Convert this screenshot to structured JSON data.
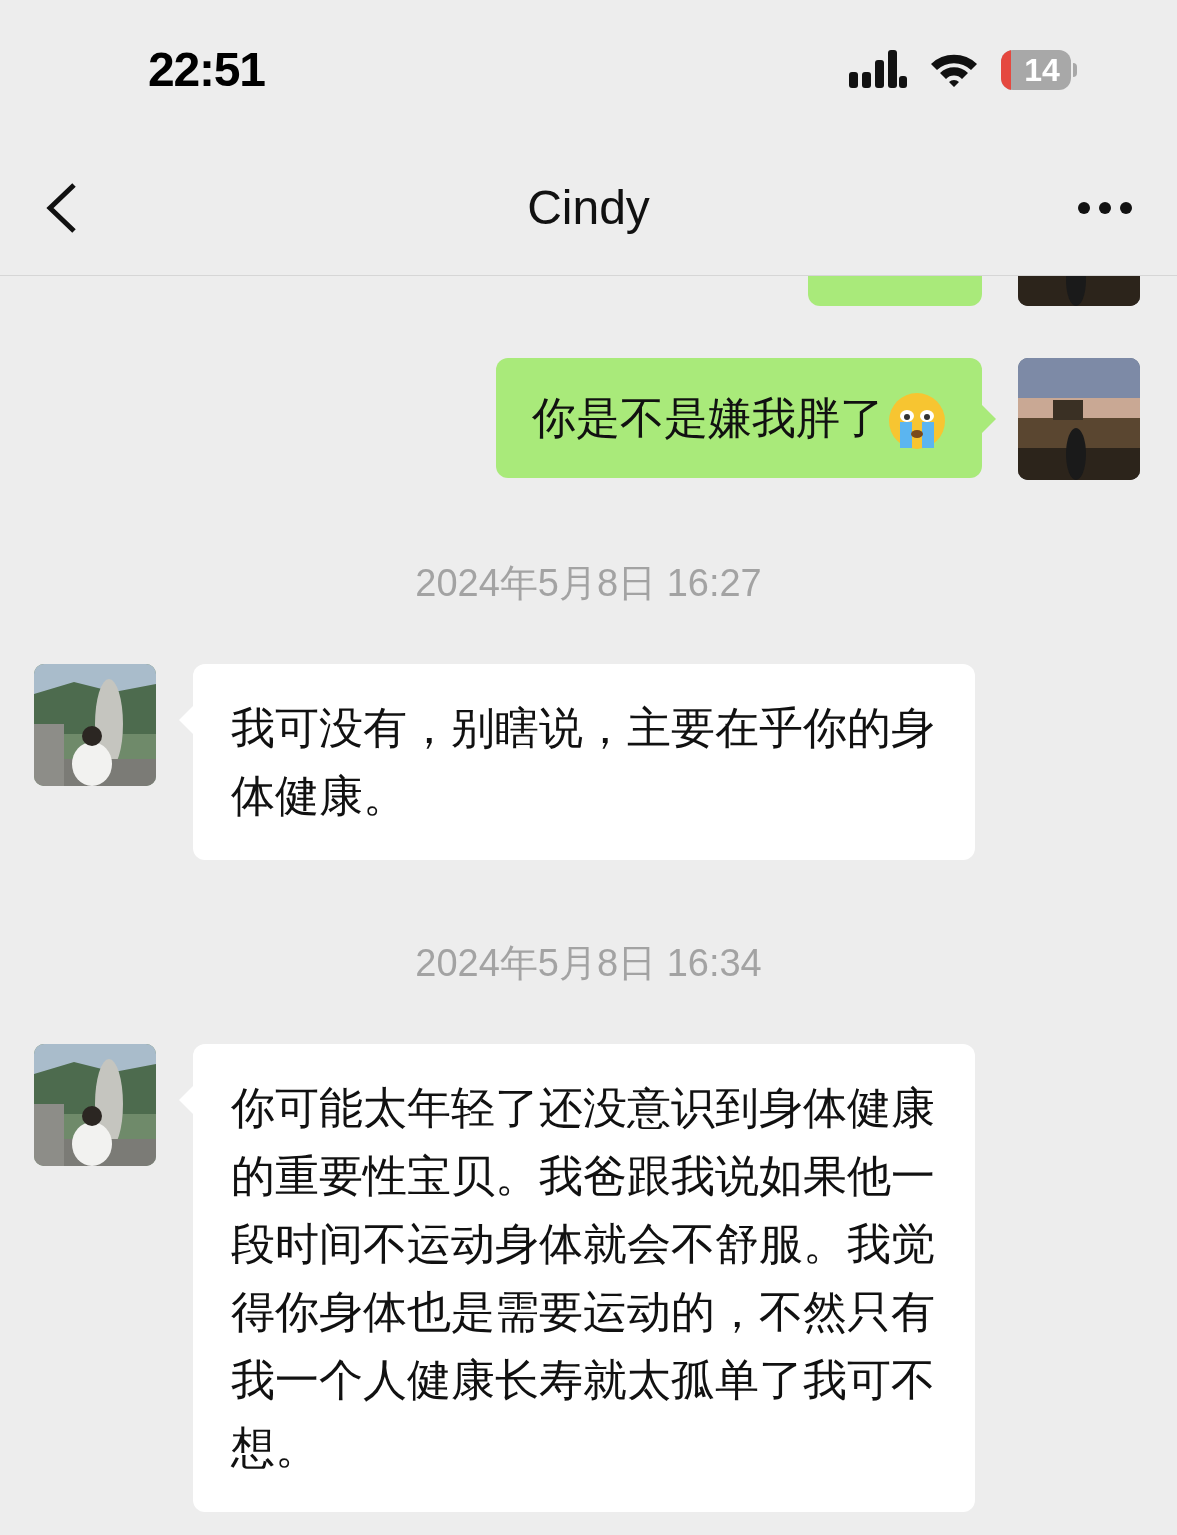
{
  "status_bar": {
    "time": "22:51",
    "battery": "14"
  },
  "header": {
    "title": "Cindy"
  },
  "items": [
    {
      "kind": "sent",
      "cut": true
    },
    {
      "kind": "sent",
      "text": "你是不是嫌我胖了",
      "emoji": true
    },
    {
      "kind": "timestamp",
      "text": "2024年5月8日 16:27"
    },
    {
      "kind": "received",
      "text": "我可没有，别瞎说，主要在乎你的身体健康。"
    },
    {
      "kind": "timestamp",
      "text": "2024年5月8日 16:34"
    },
    {
      "kind": "received",
      "text": "你可能太年轻了还没意识到身体健康的重要性宝贝。我爸跟我说如果他一段时间不运动身体就会不舒服。我觉得你身体也是需要运动的，不然只有我一个人健康长寿就太孤单了我可不想。"
    }
  ]
}
